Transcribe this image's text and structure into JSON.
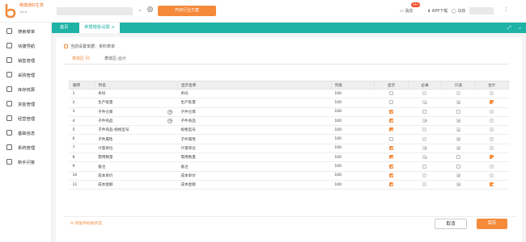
{
  "header": {
    "logo_text": "畅捷通好生意",
    "logo_sub": "Tplus",
    "orange_button": "开启行业方案",
    "messages_label": "消息",
    "messages_badge": "99+",
    "app_download": "APP下载",
    "user_prefix": "乌劲"
  },
  "sidebar": {
    "items": [
      {
        "label": "搜索菜单",
        "icon": "search-icon"
      },
      {
        "label": "快捷导航",
        "icon": "lightning-icon"
      },
      {
        "label": "销售管理",
        "icon": "sales-icon"
      },
      {
        "label": "采购管理",
        "icon": "cart-icon"
      },
      {
        "label": "库存核算",
        "icon": "box-icon"
      },
      {
        "label": "资金管理",
        "icon": "money-icon"
      },
      {
        "label": "经营管理",
        "icon": "chart-icon"
      },
      {
        "label": "基础信息",
        "icon": "info-icon"
      },
      {
        "label": "系统管理",
        "icon": "gear-icon"
      },
      {
        "label": "新手问答",
        "icon": "help-icon"
      }
    ]
  },
  "tabs": {
    "home": "首页",
    "active": "单据模板设置",
    "close": "×"
  },
  "panel": {
    "title": "当前设置单据：资料表单",
    "subtab_active": "表体区-列",
    "subtab_other": "表体区-合计"
  },
  "table": {
    "headers": [
      "顺序",
      "列名",
      "显示名称",
      "列宽",
      "显示",
      "必录",
      "只读",
      "合计"
    ],
    "rows": [
      {
        "seq": "1",
        "name": "条码",
        "display": "条码",
        "width": "100",
        "show": false,
        "show_dis": false,
        "req": false,
        "req_dis": true,
        "ro": false,
        "ro_dis": true,
        "sum": false,
        "sum_dis": true,
        "plus": false
      },
      {
        "seq": "2",
        "name": "生产批量",
        "display": "生产批量",
        "width": "100",
        "show": false,
        "show_dis": false,
        "req": true,
        "req_dis": true,
        "ro": true,
        "ro_dis": true,
        "sum": true,
        "sum_dis": false,
        "plus": false
      },
      {
        "seq": "3",
        "name": "子件仓库",
        "display": "子件仓库",
        "width": "100",
        "show": true,
        "show_dis": false,
        "req": false,
        "req_dis": false,
        "ro": false,
        "ro_dis": false,
        "sum": false,
        "sum_dis": true,
        "plus": true
      },
      {
        "seq": "4",
        "name": "子件商品",
        "display": "子件商品",
        "width": "160",
        "show": true,
        "show_dis": false,
        "req": true,
        "req_dis": true,
        "ro": true,
        "ro_dis": true,
        "sum": false,
        "sum_dis": true,
        "plus": true
      },
      {
        "seq": "5",
        "name": "子件商品-规格型号",
        "display": "规格型号",
        "width": "100",
        "show": true,
        "show_dis": false,
        "req": false,
        "req_dis": true,
        "ro": true,
        "ro_dis": true,
        "sum": false,
        "sum_dis": true,
        "plus": false
      },
      {
        "seq": "6",
        "name": "子件属性",
        "display": "子件属性",
        "width": "100",
        "show": false,
        "show_dis": false,
        "req": false,
        "req_dis": true,
        "ro": true,
        "ro_dis": true,
        "sum": false,
        "sum_dis": true,
        "plus": false
      },
      {
        "seq": "7",
        "name": "计量单位",
        "display": "计量单位",
        "width": "100",
        "show": true,
        "show_dis": false,
        "req": true,
        "req_dis": true,
        "ro": true,
        "ro_dis": true,
        "sum": false,
        "sum_dis": true,
        "plus": false
      },
      {
        "seq": "8",
        "name": "需用数量",
        "display": "需用数量",
        "width": "100",
        "show": true,
        "show_dis": false,
        "req": true,
        "req_dis": true,
        "ro": false,
        "ro_dis": false,
        "sum": true,
        "sum_dis": false,
        "plus": false
      },
      {
        "seq": "9",
        "name": "备注",
        "display": "备注",
        "width": "100",
        "show": true,
        "show_dis": false,
        "req": false,
        "req_dis": false,
        "ro": false,
        "ro_dis": false,
        "sum": false,
        "sum_dis": true,
        "plus": false
      },
      {
        "seq": "10",
        "name": "成本单价",
        "display": "成本单价",
        "width": "100",
        "show": true,
        "show_dis": false,
        "req": false,
        "req_dis": true,
        "ro": true,
        "ro_dis": true,
        "sum": false,
        "sum_dis": true,
        "plus": false
      },
      {
        "seq": "11",
        "name": "成本金额",
        "display": "成本金额",
        "width": "100",
        "show": true,
        "show_dis": false,
        "req": false,
        "req_dis": true,
        "ro": true,
        "ro_dis": true,
        "sum": true,
        "sum_dis": false,
        "plus": false
      }
    ]
  },
  "footer": {
    "reset": "恢复到初始状态",
    "cancel": "取消",
    "save": "保存"
  },
  "colors": {
    "accent": "#f58a3a",
    "teal": "#1fb3a6"
  }
}
